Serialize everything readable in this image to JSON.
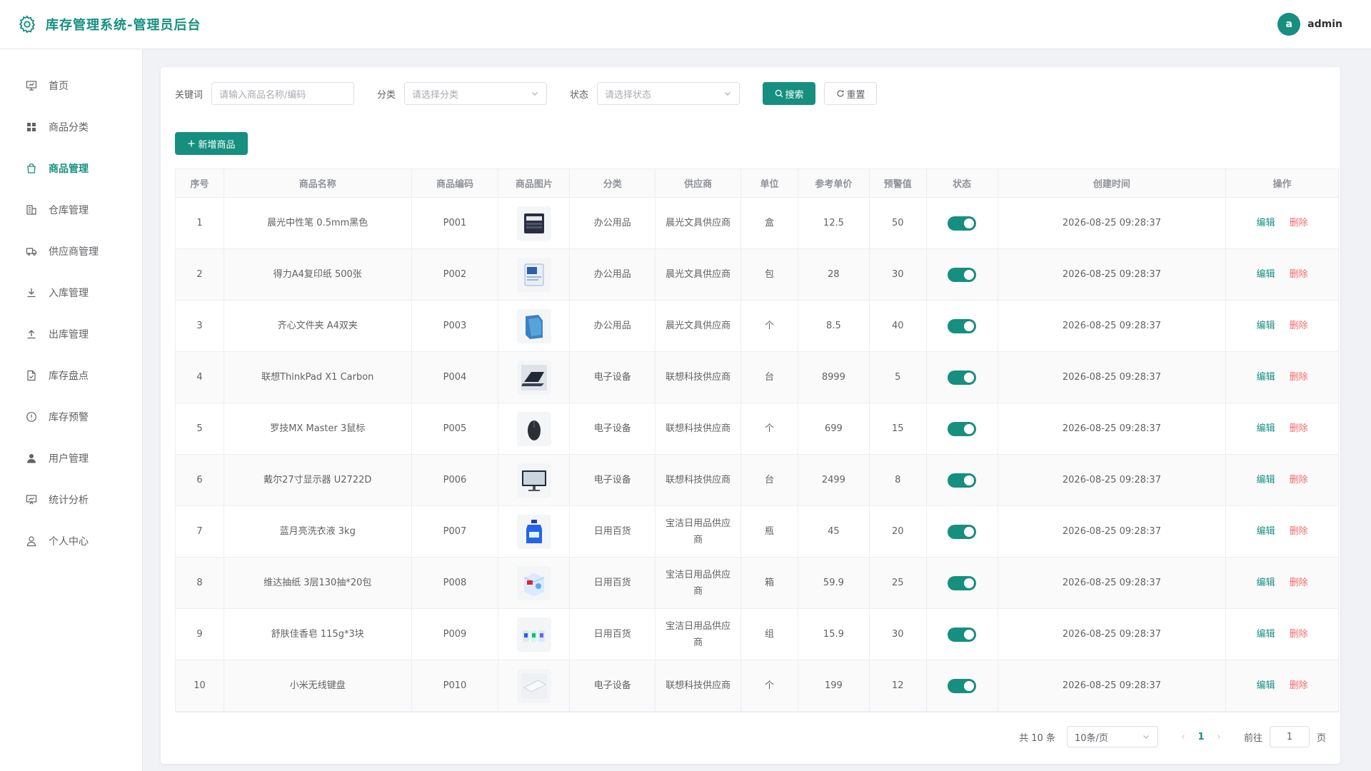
{
  "header": {
    "title": "库存管理系统-管理员后台",
    "avatar_letter": "a",
    "username": "admin"
  },
  "sidebar": {
    "items": [
      {
        "label": "首页",
        "icon": "dashboard-icon"
      },
      {
        "label": "商品分类",
        "icon": "grid-icon"
      },
      {
        "label": "商品管理",
        "icon": "shopping-bag-icon",
        "active": true
      },
      {
        "label": "仓库管理",
        "icon": "building-icon"
      },
      {
        "label": "供应商管理",
        "icon": "truck-icon"
      },
      {
        "label": "入库管理",
        "icon": "download-icon"
      },
      {
        "label": "出库管理",
        "icon": "upload-icon"
      },
      {
        "label": "库存盘点",
        "icon": "document-check-icon"
      },
      {
        "label": "库存预警",
        "icon": "warning-circle-icon"
      },
      {
        "label": "用户管理",
        "icon": "user-filled-icon"
      },
      {
        "label": "统计分析",
        "icon": "chart-board-icon"
      },
      {
        "label": "个人中心",
        "icon": "user-icon"
      }
    ]
  },
  "filters": {
    "keyword_label": "关键词",
    "keyword_placeholder": "请输入商品名称/编码",
    "category_label": "分类",
    "category_placeholder": "请选择分类",
    "status_label": "状态",
    "status_placeholder": "请选择状态",
    "search_label": "搜索",
    "reset_label": "重置"
  },
  "add_button_label": "新增商品",
  "table": {
    "headers": [
      "序号",
      "商品名称",
      "商品编码",
      "商品图片",
      "分类",
      "供应商",
      "单位",
      "参考单价",
      "预警值",
      "状态",
      "创建时间",
      "操作"
    ],
    "edit_label": "编辑",
    "delete_label": "删除",
    "rows": [
      {
        "no": "1",
        "name": "晨光中性笔 0.5mm黑色",
        "code": "P001",
        "image": "pen-box",
        "category": "办公用品",
        "supplier": "晨光文具供应商",
        "unit": "盒",
        "price": "12.5",
        "warn": "50",
        "status_on": true,
        "created": "2026-08-25 09:28:37"
      },
      {
        "no": "2",
        "name": "得力A4复印纸 500张",
        "code": "P002",
        "image": "paper-pack",
        "category": "办公用品",
        "supplier": "晨光文具供应商",
        "unit": "包",
        "price": "28",
        "warn": "30",
        "status_on": true,
        "created": "2026-08-25 09:28:37"
      },
      {
        "no": "3",
        "name": "齐心文件夹 A4双夹",
        "code": "P003",
        "image": "folder",
        "category": "办公用品",
        "supplier": "晨光文具供应商",
        "unit": "个",
        "price": "8.5",
        "warn": "40",
        "status_on": true,
        "created": "2026-08-25 09:28:37"
      },
      {
        "no": "4",
        "name": "联想ThinkPad X1 Carbon",
        "code": "P004",
        "image": "laptop",
        "category": "电子设备",
        "supplier": "联想科技供应商",
        "unit": "台",
        "price": "8999",
        "warn": "5",
        "status_on": true,
        "created": "2026-08-25 09:28:37"
      },
      {
        "no": "5",
        "name": "罗技MX Master 3鼠标",
        "code": "P005",
        "image": "mouse",
        "category": "电子设备",
        "supplier": "联想科技供应商",
        "unit": "个",
        "price": "699",
        "warn": "15",
        "status_on": true,
        "created": "2026-08-25 09:28:37"
      },
      {
        "no": "6",
        "name": "戴尔27寸显示器 U2722D",
        "code": "P006",
        "image": "monitor",
        "category": "电子设备",
        "supplier": "联想科技供应商",
        "unit": "台",
        "price": "2499",
        "warn": "8",
        "status_on": true,
        "created": "2026-08-25 09:28:37"
      },
      {
        "no": "7",
        "name": "蓝月亮洗衣液 3kg",
        "code": "P007",
        "image": "detergent-bottle",
        "category": "日用百货",
        "supplier": "宝洁日用品供应商",
        "unit": "瓶",
        "price": "45",
        "warn": "20",
        "status_on": true,
        "created": "2026-08-25 09:28:37"
      },
      {
        "no": "8",
        "name": "维达抽纸 3层130抽*20包",
        "code": "P008",
        "image": "tissue-pack",
        "category": "日用百货",
        "supplier": "宝洁日用品供应商",
        "unit": "箱",
        "price": "59.9",
        "warn": "25",
        "status_on": true,
        "created": "2026-08-25 09:28:37"
      },
      {
        "no": "9",
        "name": "舒肤佳香皂 115g*3块",
        "code": "P009",
        "image": "soap-bars",
        "category": "日用百货",
        "supplier": "宝洁日用品供应商",
        "unit": "组",
        "price": "15.9",
        "warn": "30",
        "status_on": true,
        "created": "2026-08-25 09:28:37"
      },
      {
        "no": "10",
        "name": "小米无线键盘",
        "code": "P010",
        "image": "keyboard",
        "category": "电子设备",
        "supplier": "联想科技供应商",
        "unit": "个",
        "price": "199",
        "warn": "12",
        "status_on": true,
        "created": "2026-08-25 09:28:37"
      }
    ]
  },
  "pagination": {
    "total_text": "共 10 条",
    "page_size": "10条/页",
    "current_page": "1",
    "goto_label": "前往",
    "goto_value": "1",
    "page_suffix": "页"
  },
  "colors": {
    "accent": "#168f7f",
    "danger": "#f56c6c"
  }
}
